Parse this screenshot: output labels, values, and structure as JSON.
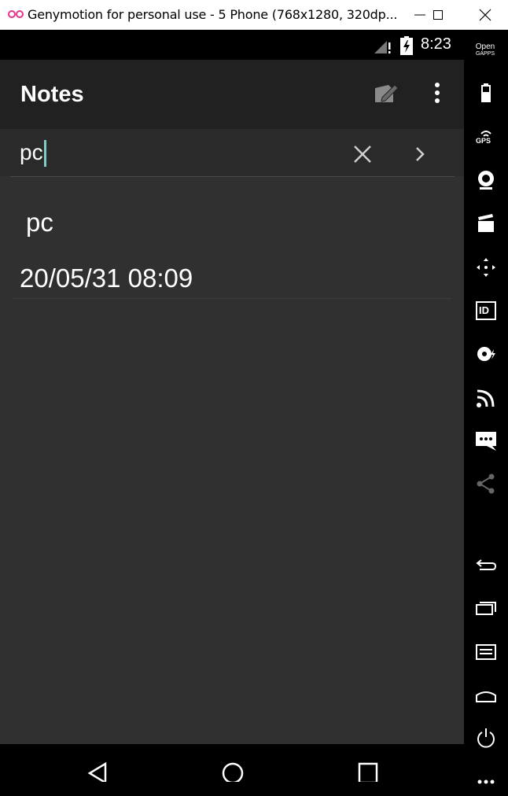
{
  "window": {
    "title": "Genymotion for personal use - 5 Phone (768x1280, 320dp..."
  },
  "status_bar": {
    "time": "8:23"
  },
  "app_bar": {
    "title": "Notes"
  },
  "search": {
    "value": "pc"
  },
  "notes": [
    {
      "title": "pc",
      "date": "20/05/31 08:09"
    }
  ],
  "sidebar": {
    "opengapps_line1": "Open",
    "opengapps_line2": "GAPPS",
    "gps_label": "GPS",
    "id_label": "ID"
  },
  "colors": {
    "cursor": "#80cbc4",
    "appbar": "#212121",
    "background": "#303030"
  }
}
